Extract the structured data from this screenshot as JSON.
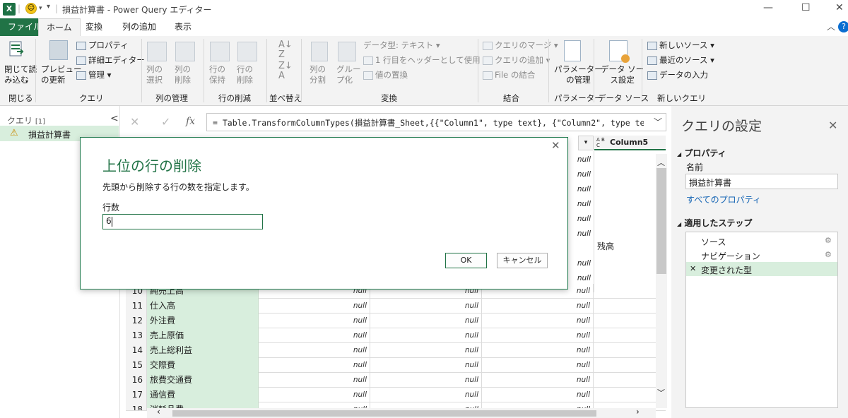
{
  "window": {
    "title": "損益計算書 - Power Query エディター",
    "separator": "|",
    "excel_logo_letter": "X"
  },
  "tabs": [
    "ファイル",
    "ホーム",
    "変換",
    "列の追加",
    "表示"
  ],
  "help_label": "?",
  "ribbon": {
    "close_load": "閉じて読\nみ込む",
    "preview_refresh": "プレビュー\nの更新",
    "properties": "プロパティ",
    "advanced_editor": "詳細エディター",
    "manage": "管理",
    "choose_columns": "列の\n選択",
    "remove_columns": "列の\n削除",
    "keep_rows": "行の\n保持",
    "remove_rows": "行の\n削除",
    "split_column": "列の\n分割",
    "group_by": "グルー\nプ化",
    "data_type": "データ型: テキスト",
    "use_first_row": "1 行目をヘッダーとして使用",
    "replace_values": "値の置換",
    "merge_queries": "クエリのマージ",
    "append_queries": "クエリの追加",
    "combine_files": "File の結合",
    "manage_params": "パラメーター\nの管理",
    "data_source_settings": "データ ソー\nス設定",
    "new_source": "新しいソース",
    "recent_sources": "最近のソース",
    "enter_data": "データの入力",
    "groups": [
      "閉じる",
      "クエリ",
      "列の管理",
      "行の削減",
      "並べ替え",
      "変換",
      "結合",
      "パラメーター",
      "データ ソース",
      "新しいクエリ"
    ]
  },
  "query_pane": {
    "header": "クエリ",
    "count": "[1]",
    "collapse_glyph": "<",
    "items": [
      "損益計算書"
    ]
  },
  "formula_bar": {
    "fx": "fx",
    "formula": "= Table.TransformColumnTypes(損益計算書_Sheet,{{\"Column1\", type text}, {\"Column2\", type text},"
  },
  "grid": {
    "visible_column_header": "Column5",
    "type_badge": "A B C",
    "null_text": "null",
    "balance_cell": "残高",
    "rows": [
      {
        "n": "10",
        "c1": "純売上高"
      },
      {
        "n": "11",
        "c1": "仕入高"
      },
      {
        "n": "12",
        "c1": "外注費"
      },
      {
        "n": "13",
        "c1": "売上原価"
      },
      {
        "n": "14",
        "c1": "売上総利益"
      },
      {
        "n": "15",
        "c1": "交際費"
      },
      {
        "n": "16",
        "c1": "旅費交通費"
      },
      {
        "n": "17",
        "c1": "通信費"
      },
      {
        "n": "18",
        "c1": "消耗品費"
      }
    ]
  },
  "settings": {
    "title": "クエリの設定",
    "properties_header": "プロパティ",
    "name_label": "名前",
    "name_value": "損益計算書",
    "all_properties": "すべてのプロパティ",
    "steps_header": "適用したステップ",
    "steps": [
      "ソース",
      "ナビゲーション",
      "変更された型"
    ]
  },
  "dialog": {
    "title": "上位の行の削除",
    "description": "先頭から削除する行の数を指定します。",
    "field_label": "行数",
    "field_value": "6",
    "ok": "OK",
    "cancel": "キャンセル"
  },
  "colors": {
    "accent": "#217346",
    "selected_column": "#d8eedd",
    "ribbon_bg": "#f3f3f3"
  }
}
